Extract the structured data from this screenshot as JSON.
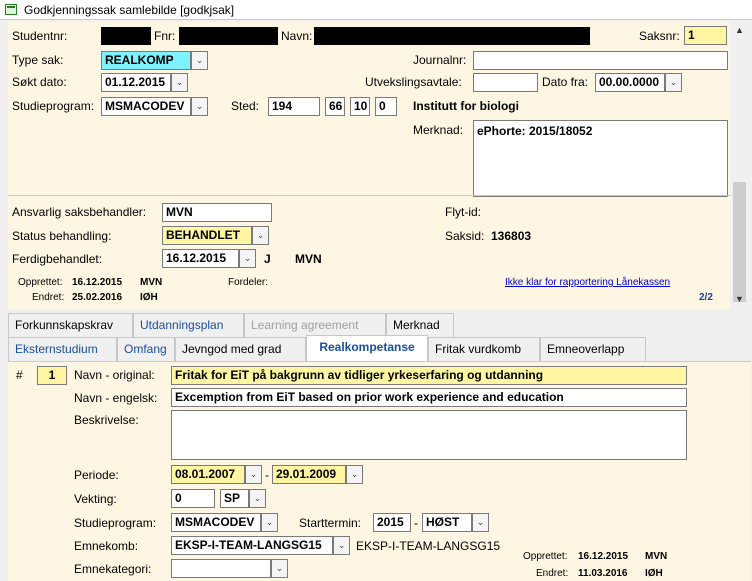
{
  "window": {
    "title": "Godkjenningssak samlebilde  [godkjsak]"
  },
  "header": {
    "studentnr_label": "Studentnr:",
    "fnr_label": "Fnr:",
    "navn_label": "Navn:",
    "saksnr_label": "Saksnr:",
    "saksnr_value": "1",
    "type_sak_label": "Type sak:",
    "type_sak_value": "REALKOMP",
    "journalnr_label": "Journalnr:",
    "journalnr_value": "",
    "sokt_dato_label": "Søkt dato:",
    "sokt_dato_value": "01.12.2015",
    "utvekslingsavtale_label": "Utvekslingsavtale:",
    "utvekslingsavtale_value": "",
    "dato_fra_label": "Dato fra:",
    "dato_fra_value": "00.00.0000",
    "studieprogram_label": "Studieprogram:",
    "studieprogram_value": "MSMACODEV",
    "sted_label": "Sted:",
    "sted_values": [
      "194",
      "66",
      "10",
      "0"
    ],
    "sted_name": "Institutt for biologi",
    "merknad_label": "Merknad:",
    "merknad_value": "ePhorte: 2015/18052",
    "ansvarlig_label": "Ansvarlig saksbehandler:",
    "ansvarlig_value": "MVN",
    "flyt_id_label": "Flyt-id:",
    "status_label": "Status behandling:",
    "status_value": "BEHANDLET",
    "saksid_label": "Saksid:",
    "saksid_value": "136803",
    "ferdig_label": "Ferdigbehandlet:",
    "ferdig_date": "16.12.2015",
    "ferdig_flag": "J",
    "ferdig_user": "MVN",
    "opprettet_label": "Opprettet:",
    "opprettet_date": "16.12.2015",
    "opprettet_user": "MVN",
    "endret_label": "Endret:",
    "endret_date": "25.02.2016",
    "endret_user": "IØH",
    "fordeler_label": "Fordeler:",
    "lanekassen_link": "Ikke klar for rapportering Lånekassen",
    "record_counter": "2/2"
  },
  "tabs_row1": [
    "Forkunnskapskrav",
    "Utdanningsplan",
    "Learning agreement",
    "Merknad"
  ],
  "tabs_row2": [
    "Eksternstudium",
    "Omfang",
    "Jevngod med grad",
    "Realkompetanse",
    "Fritak vurdkomb",
    "Emneoverlapp"
  ],
  "detail": {
    "hash_label": "#",
    "number": "1",
    "navn_original_label": "Navn - original:",
    "navn_original_value": "Fritak for EiT på bakgrunn av tidliger yrkeserfaring og utdanning",
    "navn_engelsk_label": "Navn - engelsk:",
    "navn_engelsk_value": "Excemption from EiT based on prior work experience and education",
    "beskrivelse_label": "Beskrivelse:",
    "beskrivelse_value": "",
    "periode_label": "Periode:",
    "periode_from": "08.01.2007",
    "periode_dash": "-",
    "periode_to": "29.01.2009",
    "vekting_label": "Vekting:",
    "vekting_value": "0",
    "vekting_unit": "SP",
    "studieprogram_label": "Studieprogram:",
    "studieprogram_value": "MSMACODEV",
    "starttermin_label": "Starttermin:",
    "starttermin_year": "2015",
    "starttermin_dash": "-",
    "starttermin_term": "HØST",
    "emnekomb_label": "Emnekomb:",
    "emnekomb_value": "EKSP-I-TEAM-LANGSG15",
    "emnekomb_text": "EKSP-I-TEAM-LANGSG15",
    "emnekategori_label": "Emnekategori:",
    "emnekategori_value": "",
    "opprettet_label": "Opprettet:",
    "opprettet_date": "16.12.2015",
    "opprettet_user": "MVN",
    "endret_label": "Endret:",
    "endret_date": "11.03.2016",
    "endret_user": "IØH"
  }
}
